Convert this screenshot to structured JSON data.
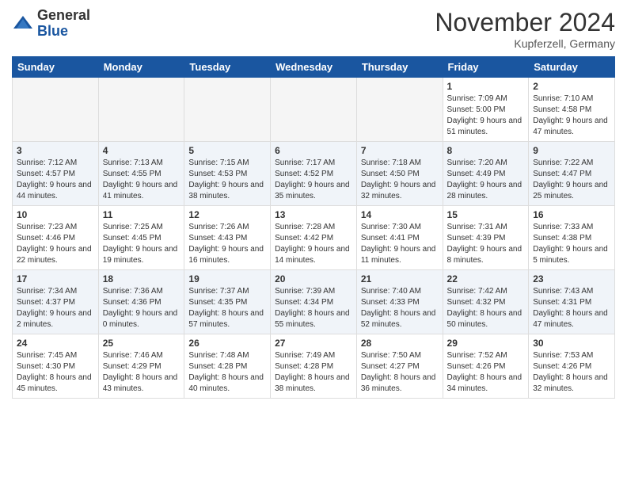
{
  "logo": {
    "general": "General",
    "blue": "Blue"
  },
  "title": "November 2024",
  "location": "Kupferzell, Germany",
  "days_of_week": [
    "Sunday",
    "Monday",
    "Tuesday",
    "Wednesday",
    "Thursday",
    "Friday",
    "Saturday"
  ],
  "weeks": [
    [
      {
        "day": "",
        "info": ""
      },
      {
        "day": "",
        "info": ""
      },
      {
        "day": "",
        "info": ""
      },
      {
        "day": "",
        "info": ""
      },
      {
        "day": "",
        "info": ""
      },
      {
        "day": "1",
        "info": "Sunrise: 7:09 AM\nSunset: 5:00 PM\nDaylight: 9 hours and 51 minutes."
      },
      {
        "day": "2",
        "info": "Sunrise: 7:10 AM\nSunset: 4:58 PM\nDaylight: 9 hours and 47 minutes."
      }
    ],
    [
      {
        "day": "3",
        "info": "Sunrise: 7:12 AM\nSunset: 4:57 PM\nDaylight: 9 hours and 44 minutes."
      },
      {
        "day": "4",
        "info": "Sunrise: 7:13 AM\nSunset: 4:55 PM\nDaylight: 9 hours and 41 minutes."
      },
      {
        "day": "5",
        "info": "Sunrise: 7:15 AM\nSunset: 4:53 PM\nDaylight: 9 hours and 38 minutes."
      },
      {
        "day": "6",
        "info": "Sunrise: 7:17 AM\nSunset: 4:52 PM\nDaylight: 9 hours and 35 minutes."
      },
      {
        "day": "7",
        "info": "Sunrise: 7:18 AM\nSunset: 4:50 PM\nDaylight: 9 hours and 32 minutes."
      },
      {
        "day": "8",
        "info": "Sunrise: 7:20 AM\nSunset: 4:49 PM\nDaylight: 9 hours and 28 minutes."
      },
      {
        "day": "9",
        "info": "Sunrise: 7:22 AM\nSunset: 4:47 PM\nDaylight: 9 hours and 25 minutes."
      }
    ],
    [
      {
        "day": "10",
        "info": "Sunrise: 7:23 AM\nSunset: 4:46 PM\nDaylight: 9 hours and 22 minutes."
      },
      {
        "day": "11",
        "info": "Sunrise: 7:25 AM\nSunset: 4:45 PM\nDaylight: 9 hours and 19 minutes."
      },
      {
        "day": "12",
        "info": "Sunrise: 7:26 AM\nSunset: 4:43 PM\nDaylight: 9 hours and 16 minutes."
      },
      {
        "day": "13",
        "info": "Sunrise: 7:28 AM\nSunset: 4:42 PM\nDaylight: 9 hours and 14 minutes."
      },
      {
        "day": "14",
        "info": "Sunrise: 7:30 AM\nSunset: 4:41 PM\nDaylight: 9 hours and 11 minutes."
      },
      {
        "day": "15",
        "info": "Sunrise: 7:31 AM\nSunset: 4:39 PM\nDaylight: 9 hours and 8 minutes."
      },
      {
        "day": "16",
        "info": "Sunrise: 7:33 AM\nSunset: 4:38 PM\nDaylight: 9 hours and 5 minutes."
      }
    ],
    [
      {
        "day": "17",
        "info": "Sunrise: 7:34 AM\nSunset: 4:37 PM\nDaylight: 9 hours and 2 minutes."
      },
      {
        "day": "18",
        "info": "Sunrise: 7:36 AM\nSunset: 4:36 PM\nDaylight: 9 hours and 0 minutes."
      },
      {
        "day": "19",
        "info": "Sunrise: 7:37 AM\nSunset: 4:35 PM\nDaylight: 8 hours and 57 minutes."
      },
      {
        "day": "20",
        "info": "Sunrise: 7:39 AM\nSunset: 4:34 PM\nDaylight: 8 hours and 55 minutes."
      },
      {
        "day": "21",
        "info": "Sunrise: 7:40 AM\nSunset: 4:33 PM\nDaylight: 8 hours and 52 minutes."
      },
      {
        "day": "22",
        "info": "Sunrise: 7:42 AM\nSunset: 4:32 PM\nDaylight: 8 hours and 50 minutes."
      },
      {
        "day": "23",
        "info": "Sunrise: 7:43 AM\nSunset: 4:31 PM\nDaylight: 8 hours and 47 minutes."
      }
    ],
    [
      {
        "day": "24",
        "info": "Sunrise: 7:45 AM\nSunset: 4:30 PM\nDaylight: 8 hours and 45 minutes."
      },
      {
        "day": "25",
        "info": "Sunrise: 7:46 AM\nSunset: 4:29 PM\nDaylight: 8 hours and 43 minutes."
      },
      {
        "day": "26",
        "info": "Sunrise: 7:48 AM\nSunset: 4:28 PM\nDaylight: 8 hours and 40 minutes."
      },
      {
        "day": "27",
        "info": "Sunrise: 7:49 AM\nSunset: 4:28 PM\nDaylight: 8 hours and 38 minutes."
      },
      {
        "day": "28",
        "info": "Sunrise: 7:50 AM\nSunset: 4:27 PM\nDaylight: 8 hours and 36 minutes."
      },
      {
        "day": "29",
        "info": "Sunrise: 7:52 AM\nSunset: 4:26 PM\nDaylight: 8 hours and 34 minutes."
      },
      {
        "day": "30",
        "info": "Sunrise: 7:53 AM\nSunset: 4:26 PM\nDaylight: 8 hours and 32 minutes."
      }
    ]
  ]
}
